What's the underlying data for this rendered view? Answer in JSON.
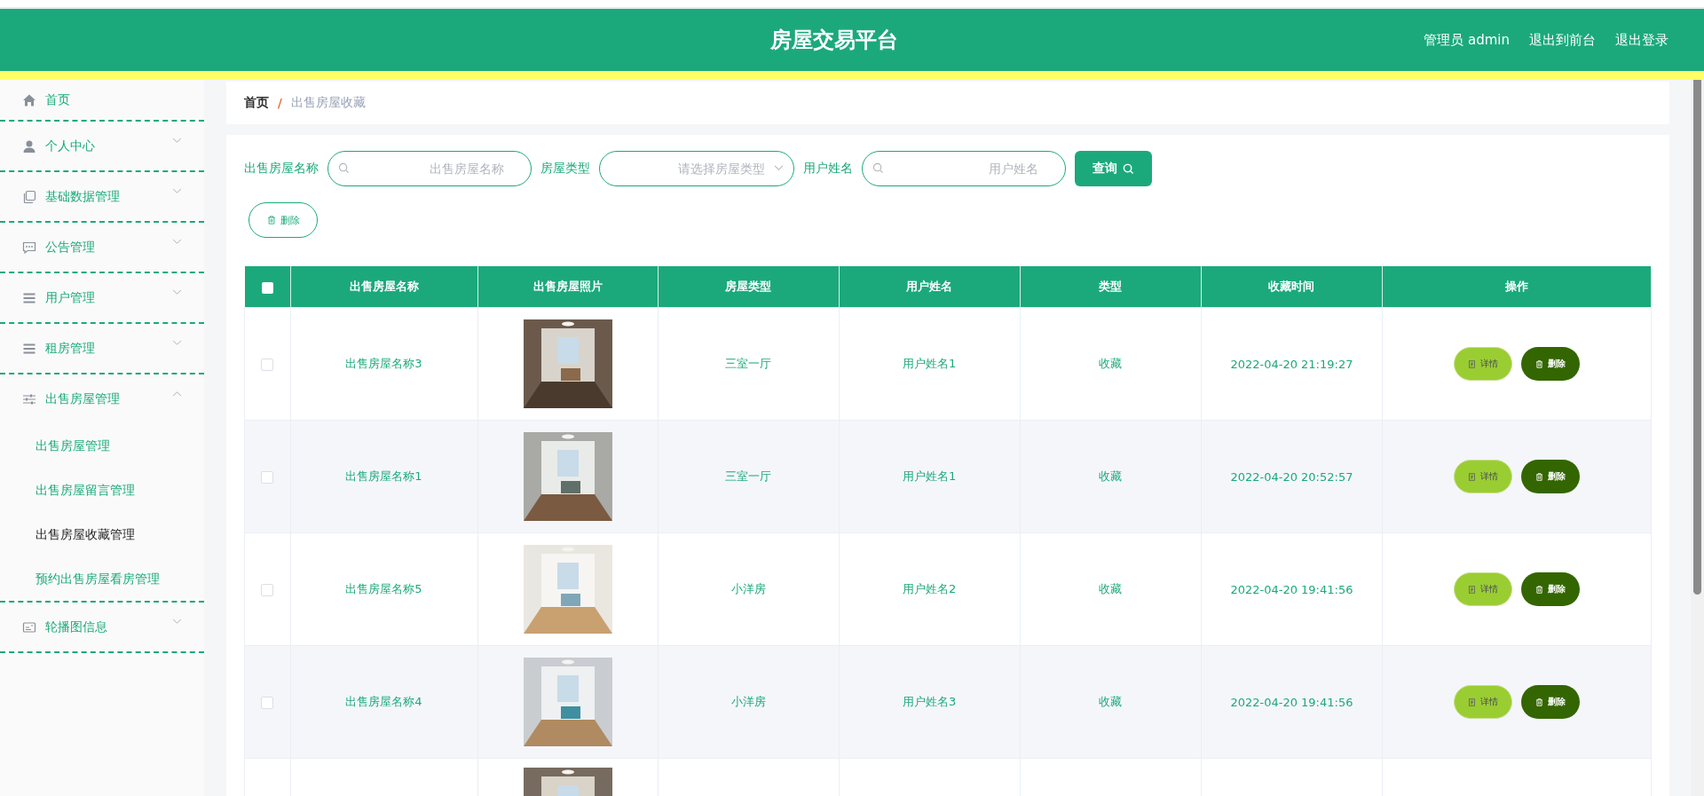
{
  "header": {
    "title": "房屋交易平台",
    "links": [
      "管理员 admin",
      "退出到前台",
      "退出登录"
    ]
  },
  "sidebar": {
    "items": [
      {
        "label": "首页"
      },
      {
        "label": "个人中心",
        "expanded": false
      },
      {
        "label": "基础数据管理",
        "expanded": false
      },
      {
        "label": "公告管理",
        "expanded": false
      },
      {
        "label": "用户管理",
        "expanded": false
      },
      {
        "label": "租房管理",
        "expanded": false
      },
      {
        "label": "出售房屋管理",
        "expanded": true,
        "children": [
          {
            "label": "出售房屋管理",
            "selected": false
          },
          {
            "label": "出售房屋留言管理",
            "selected": false
          },
          {
            "label": "出售房屋收藏管理",
            "selected": true
          },
          {
            "label": "预约出售房屋看房管理",
            "selected": false
          }
        ]
      },
      {
        "label": "轮播图信息",
        "expanded": false
      }
    ]
  },
  "breadcrumb": {
    "items": [
      "首页",
      "出售房屋收藏"
    ],
    "separator": "/"
  },
  "filters": [
    {
      "kind": "text",
      "label": "出售房屋名称",
      "placeholder": "出售房屋名称"
    },
    {
      "kind": "select",
      "label": "房屋类型",
      "placeholder": "请选择房屋类型"
    },
    {
      "kind": "text",
      "label": "用户姓名",
      "placeholder": "用户姓名"
    }
  ],
  "search_button": "查询",
  "delete_button": "删除",
  "table": {
    "columns": [
      "出售房屋名称",
      "出售房屋照片",
      "房屋类型",
      "用户姓名",
      "类型",
      "收藏时间",
      "操作"
    ],
    "header_checked": false,
    "rows": [
      {
        "kind": "full",
        "checked": false,
        "name": "出售房屋名称3",
        "house_type": "三室一厅",
        "user": "用户姓名1",
        "type": "收藏",
        "time": "2022-04-20 21:19:27",
        "actions": [
          "详情",
          "删除"
        ]
      },
      {
        "kind": "full",
        "checked": false,
        "name": "出售房屋名称1",
        "house_type": "三室一厅",
        "user": "用户姓名1",
        "type": "收藏",
        "time": "2022-04-20 20:52:57",
        "actions": [
          "详情",
          "删除"
        ]
      },
      {
        "kind": "full",
        "checked": false,
        "name": "出售房屋名称5",
        "house_type": "小洋房",
        "user": "用户姓名2",
        "type": "收藏",
        "time": "2022-04-20 19:41:56",
        "actions": [
          "详情",
          "删除"
        ]
      },
      {
        "kind": "full",
        "checked": false,
        "name": "出售房屋名称4",
        "house_type": "小洋房",
        "user": "用户姓名3",
        "type": "收藏",
        "time": "2022-04-20 19:41:56",
        "actions": [
          "详情",
          "删除"
        ]
      },
      {
        "kind": "partial"
      }
    ]
  }
}
